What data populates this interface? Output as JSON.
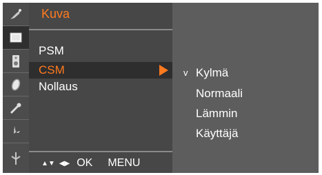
{
  "icons": [
    {
      "name": "picture-settings-icon",
      "active": false
    },
    {
      "name": "screen-icon",
      "active": true
    },
    {
      "name": "speaker-icon",
      "active": false
    },
    {
      "name": "timer-icon",
      "active": false
    },
    {
      "name": "key-icon",
      "active": false
    },
    {
      "name": "antenna-icon",
      "active": false
    }
  ],
  "main_menu": {
    "title": "Kuva",
    "items": [
      {
        "label": "PSM",
        "selected": false
      },
      {
        "label": "CSM",
        "selected": true
      },
      {
        "label": "Nollaus",
        "selected": false
      }
    ]
  },
  "nav_bar": {
    "updown": "▲▼",
    "leftright": "◀▶",
    "ok": "OK",
    "menu": "MENU"
  },
  "sub_menu": {
    "items": [
      {
        "label": "Kylmä",
        "checked": true,
        "check_mark": "v"
      },
      {
        "label": "Normaali",
        "checked": false,
        "check_mark": ""
      },
      {
        "label": "Lämmin",
        "checked": false,
        "check_mark": ""
      },
      {
        "label": "Käyttäjä",
        "checked": false,
        "check_mark": ""
      }
    ]
  },
  "colors": {
    "accent": "#ff7a1f",
    "panel": "#474747",
    "background": "#5d5d5d"
  }
}
